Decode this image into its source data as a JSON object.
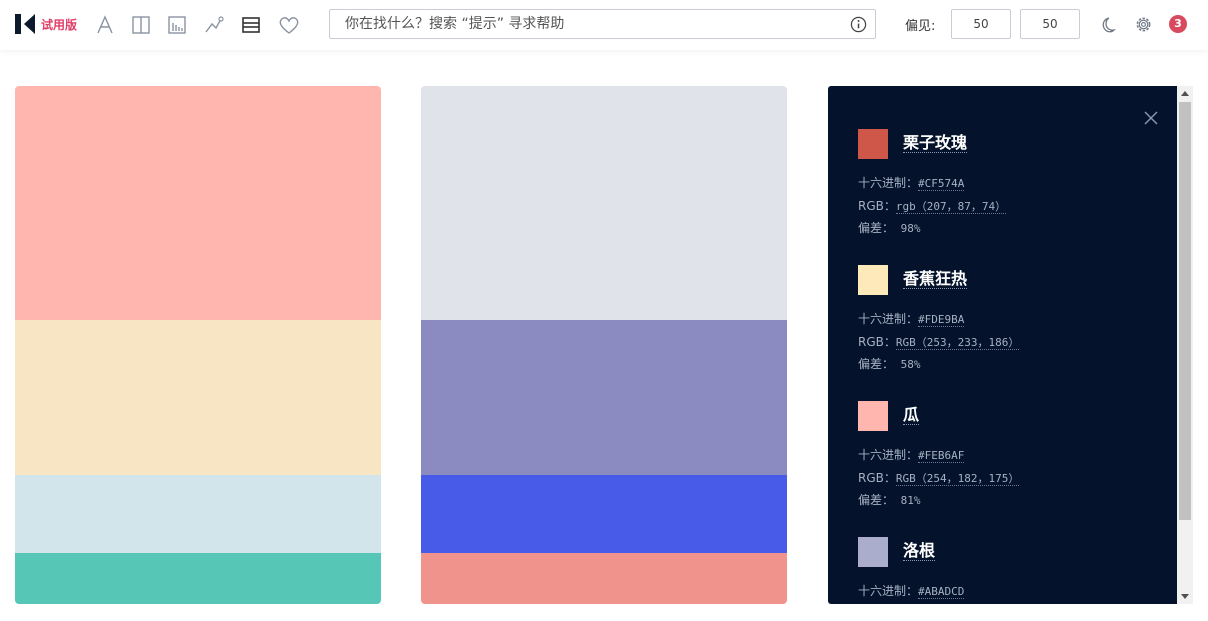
{
  "header": {
    "trial_label": "试用版",
    "search_placeholder": "你在找什么？搜索 “提示” 寻求帮助",
    "deviation_label": "偏见:",
    "deviation_min": "50",
    "deviation_max": "50",
    "notification_count": "3",
    "tools": [
      "font-icon",
      "columns-icon",
      "bar-chart-icon",
      "scatter-icon",
      "list-icon",
      "heart-icon"
    ]
  },
  "palettes": [
    {
      "colors": [
        "#FEB6AF",
        "#F8E5C3",
        "#D2E5EA",
        "#56C7B7"
      ],
      "heights": [
        234,
        155,
        78,
        51
      ]
    },
    {
      "colors": [
        "#E0E4EA",
        "#8C8BC1",
        "#475BE8",
        "#F1938D"
      ],
      "heights": [
        234,
        155,
        78,
        51
      ]
    }
  ],
  "detail": {
    "colors": [
      {
        "name": "栗子玫瑰",
        "swatch": "#CF574A",
        "hex_label": "十六进制：",
        "hex": "#CF574A",
        "rgb_label": "RGB：",
        "rgb": "rgb（207，87，74）",
        "dev_label": "偏差：",
        "dev": " 98%"
      },
      {
        "name": "香蕉狂热",
        "swatch": "#FDE9BA",
        "hex_label": "十六进制：",
        "hex": "#FDE9BA",
        "rgb_label": "RGB：",
        "rgb": "RGB（253，233，186）",
        "dev_label": "偏差：",
        "dev": " 58%"
      },
      {
        "name": "瓜",
        "swatch": "#FEB6AF",
        "hex_label": "十六进制：",
        "hex": "#FEB6AF",
        "rgb_label": "RGB：",
        "rgb": "RGB（254，182，175）",
        "dev_label": "偏差：",
        "dev": " 81%"
      },
      {
        "name": "洛根",
        "swatch": "#ABADCD",
        "hex_label": "十六进制：",
        "hex": "#ABADCD"
      }
    ],
    "panel_bg": "#04122B"
  }
}
